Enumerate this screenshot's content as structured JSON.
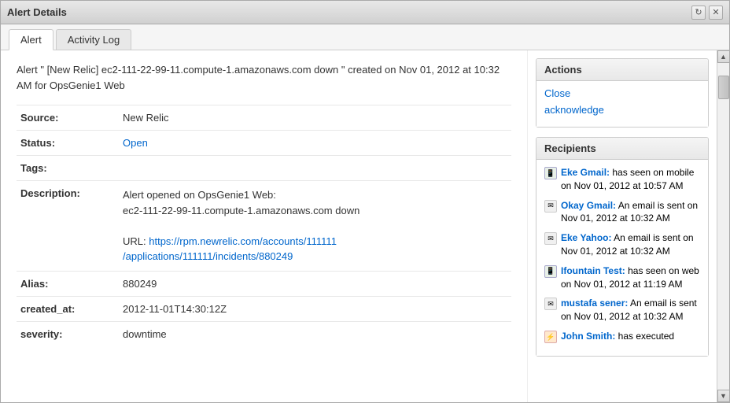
{
  "dialog": {
    "title": "Alert Details",
    "refresh_icon": "↻",
    "close_icon": "✕"
  },
  "tabs": [
    {
      "id": "alert",
      "label": "Alert",
      "active": true
    },
    {
      "id": "activity-log",
      "label": "Activity Log",
      "active": false
    }
  ],
  "alert": {
    "header": "Alert \" [New Relic] ec2-111-22-99-11.compute-1.amazonaws.com down \" created on Nov 01, 2012 at 10:32 AM for OpsGenie1 Web",
    "fields": [
      {
        "label": "Source:",
        "value": "New Relic",
        "type": "text"
      },
      {
        "label": "Status:",
        "value": "Open",
        "type": "status"
      },
      {
        "label": "Tags:",
        "value": "",
        "type": "text"
      },
      {
        "label": "Description:",
        "value": "Alert opened on OpsGenie1 Web:\nec2-111-22-99-11.compute-1.amazonaws.com down\n\nURL: https://rpm.newrelic.com/accounts/111111/applications/111111/incidents/880249",
        "type": "description",
        "url": "https://rpm.newrelic.com/accounts/111111/applications/111111/incidents/880249",
        "url_text": "https://rpm.newrelic.com/accounts/111111\n/applications/111111/incidents/880249"
      },
      {
        "label": "Alias:",
        "value": "880249",
        "type": "text"
      },
      {
        "label": "created_at:",
        "value": "2012-11-01T14:30:12Z",
        "type": "text"
      },
      {
        "label": "severity:",
        "value": "downtime",
        "type": "text"
      }
    ]
  },
  "actions": {
    "title": "Actions",
    "items": [
      {
        "label": "Close"
      },
      {
        "label": "acknowledge"
      }
    ]
  },
  "recipients": {
    "title": "Recipients",
    "items": [
      {
        "name": "Eke Gmail:",
        "text": "has seen on mobile on Nov 01, 2012 at 10:57 AM",
        "icon_type": "mobile"
      },
      {
        "name": "Okay Gmail:",
        "text": "An email is sent on Nov 01, 2012 at 10:32 AM",
        "icon_type": "email"
      },
      {
        "name": "Eke Yahoo:",
        "text": "An email is sent on Nov 01, 2012 at 10:32 AM",
        "icon_type": "email"
      },
      {
        "name": "Ifountain Test:",
        "text": "has seen on web on Nov 01, 2012 at 11:19 AM",
        "icon_type": "mobile"
      },
      {
        "name": "mustafa sener:",
        "text": "An email is sent on Nov 01, 2012 at 10:32 AM",
        "icon_type": "email"
      },
      {
        "name": "John Smith:",
        "text": "has executed",
        "icon_type": "script"
      }
    ]
  }
}
